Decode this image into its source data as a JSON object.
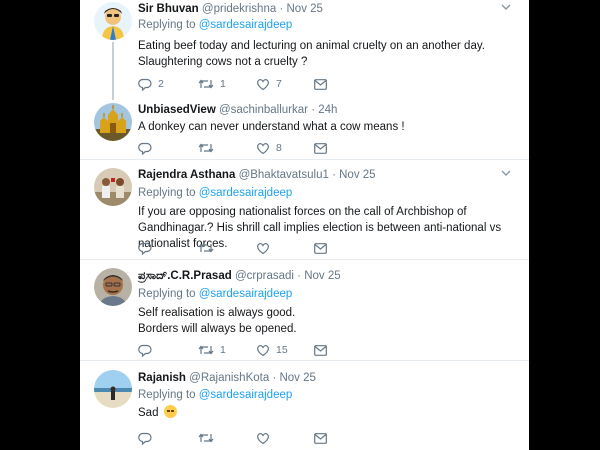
{
  "tweets": [
    {
      "name": "Sir Bhuvan",
      "handle": "@pridekrishna",
      "dot": "·",
      "time": "Nov 25",
      "replying_prefix": "Replying to",
      "replying_mention": "@sardesairajdeep",
      "text": "Eating beef today and lecturing on animal cruelty on an another day. Slaughtering cows not a cruelty  ?",
      "replies": "2",
      "retweets": "1",
      "likes": "7"
    },
    {
      "name": "UnbiasedView",
      "handle": "@sachinballurkar",
      "dot": "·",
      "time": "24h",
      "text": "A donkey can never understand what a cow means !",
      "replies": "",
      "retweets": "",
      "likes": "8"
    },
    {
      "name": "Rajendra Asthana",
      "handle": "@Bhaktavatsulu1",
      "dot": "·",
      "time": "Nov 25",
      "replying_prefix": "Replying to",
      "replying_mention": "@sardesairajdeep",
      "text": "If you are opposing nationalist forces on the call of Archbishop of Gandhinagar.? His shrill call implies election is between anti-national vs nationalist forces.",
      "replies": "",
      "retweets": "",
      "likes": ""
    },
    {
      "name": "ಪ್ರಸಾದ್.C.R.Prasad",
      "handle": "@crprasadi",
      "dot": "·",
      "time": "Nov 25",
      "replying_prefix": "Replying to",
      "replying_mention": "@sardesairajdeep",
      "text_line1": "Self realisation is always good.",
      "text_line2": "Borders will always be opened.",
      "replies": "",
      "retweets": "1",
      "likes": "15"
    },
    {
      "name": "Rajanish",
      "handle": "@RajanishKota",
      "dot": "·",
      "time": "Nov 25",
      "replying_prefix": "Replying to",
      "replying_mention": "@sardesairajdeep",
      "text": "Sad",
      "emoji": "relieved-face-emoji",
      "replies": "",
      "retweets": "",
      "likes": ""
    }
  ],
  "icons": {
    "reply": "reply-icon",
    "retweet": "retweet-icon",
    "like": "heart-icon",
    "dm": "envelope-icon",
    "caret": "chevron-down-icon"
  },
  "colors": {
    "link": "#1da1f2",
    "secondary_text": "#657786",
    "thread_line": "#c4cfd6",
    "divider": "#e6ecf0"
  }
}
